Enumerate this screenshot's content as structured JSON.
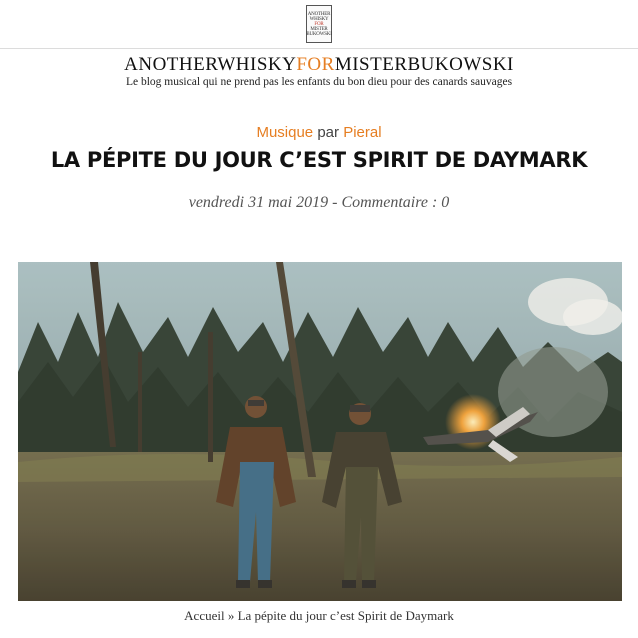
{
  "header": {
    "logo_lines": [
      "ANOTHER",
      "WHISKY",
      "FOR",
      "MISTER",
      "BUKOWSKI"
    ],
    "title_part1": "ANOTHERWHISKY",
    "title_accent": "FOR",
    "title_part2": "MISTERBUKOWSKI",
    "tagline": "Le blog musical qui ne prend pas les enfants du bon dieu pour des canards sauvages",
    "accent_color": "#e67e22"
  },
  "post": {
    "category": "Musique",
    "by": "par",
    "author": "Pieral",
    "title": "LA PÉPITE DU JOUR C’EST SPIRIT DE DAYMARK",
    "date": "vendredi 31 mai 2019",
    "separator": " - ",
    "comments": "Commentaire : 0"
  },
  "breadcrumb": {
    "home": "Accueil",
    "separator": " » ",
    "current": "La pépite du jour c’est Spirit de Daymark"
  }
}
